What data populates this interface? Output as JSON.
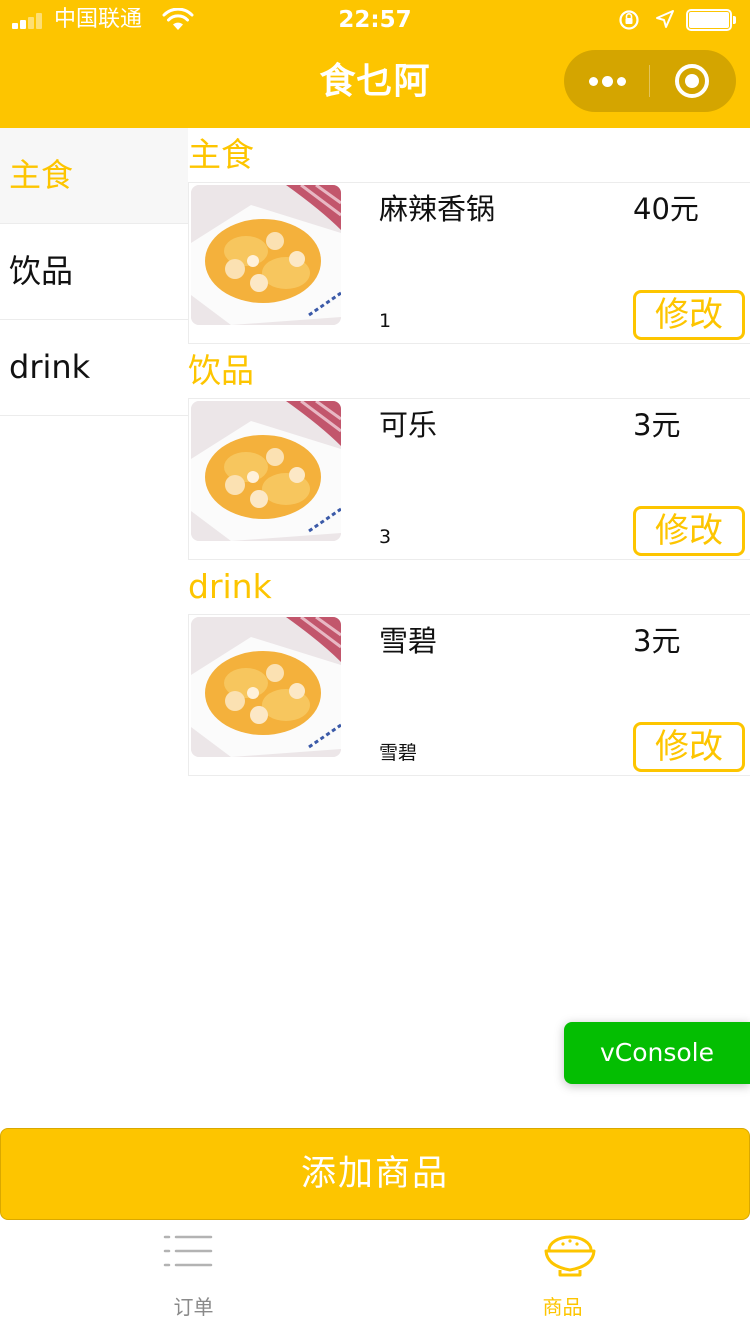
{
  "status_bar": {
    "carrier": "中国联通",
    "time": "22:57",
    "signal_icon": "signal-bars-icon",
    "wifi_icon": "wifi-icon",
    "orientation_icon": "orientation-lock-icon",
    "location_icon": "location-arrow-icon",
    "battery_icon": "battery-icon"
  },
  "nav": {
    "title": "食乜阿",
    "more_icon": "more-dots-icon",
    "close_icon": "close-target-icon"
  },
  "sidebar": {
    "items": [
      {
        "label": "主食",
        "active": true
      },
      {
        "label": "饮品",
        "active": false
      },
      {
        "label": "drink",
        "active": false
      }
    ]
  },
  "sections": [
    {
      "title": "主食",
      "products": [
        {
          "name": "麻辣香锅",
          "price": "40元",
          "desc": "1",
          "edit_label": "修改"
        }
      ]
    },
    {
      "title": "饮品",
      "products": [
        {
          "name": "可乐",
          "price": "3元",
          "desc": "3",
          "edit_label": "修改"
        }
      ]
    },
    {
      "title": "drink",
      "products": [
        {
          "name": "雪碧",
          "price": "3元",
          "desc": "雪碧",
          "edit_label": "修改"
        }
      ]
    }
  ],
  "vconsole": {
    "label": "vConsole"
  },
  "add_button": {
    "label": "添加商品"
  },
  "tabbar": {
    "tabs": [
      {
        "label": "订单",
        "icon": "list-lines-icon",
        "active": false
      },
      {
        "label": "商品",
        "icon": "rice-bowl-icon",
        "active": true
      }
    ]
  },
  "colors": {
    "accent": "#fdc500",
    "vconsole_green": "#04be02",
    "inactive_tab": "#8a8a8a"
  }
}
